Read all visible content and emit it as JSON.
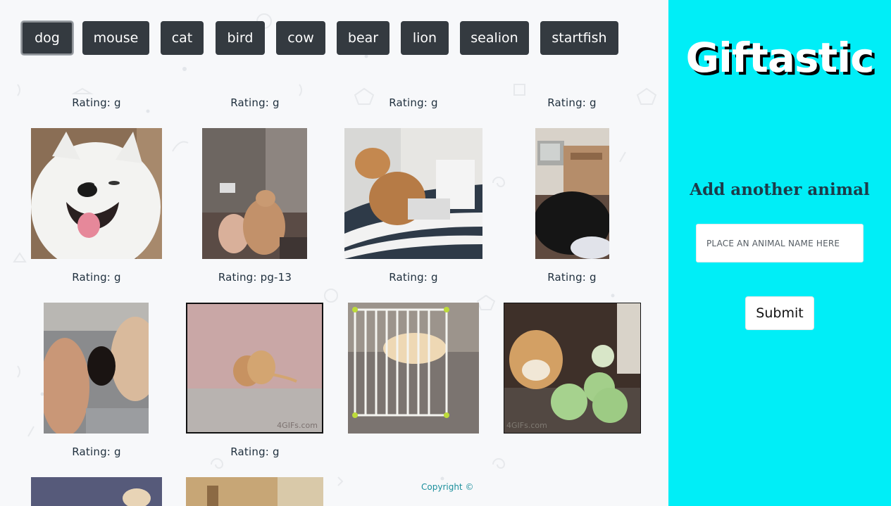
{
  "buttons": [
    "dog",
    "mouse",
    "cat",
    "bird",
    "cow",
    "bear",
    "lion",
    "sealion",
    "startfish"
  ],
  "active_button": "dog",
  "gifs": [
    {
      "rating": "Rating: g"
    },
    {
      "rating": "Rating: g"
    },
    {
      "rating": "Rating: g"
    },
    {
      "rating": "Rating: g"
    },
    {
      "rating": "Rating: g"
    },
    {
      "rating": "Rating: pg-13"
    },
    {
      "rating": "Rating: g"
    },
    {
      "rating": "Rating: g"
    },
    {
      "rating": "Rating: g"
    },
    {
      "rating": "Rating: g"
    }
  ],
  "watermarks": {
    "gif6": "4GIFs.com",
    "gif8": "4GIFs.com"
  },
  "footer": {
    "copyright": "Copyright ©"
  },
  "sidebar": {
    "brand": "Giftastic",
    "add_title": "Add another animal",
    "input_placeholder": "PLACE AN ANIMAL NAME HERE",
    "input_value": "",
    "submit_label": "Submit"
  },
  "colors": {
    "sidebar_bg": "#00eef7",
    "button_bg": "#343a40",
    "page_bg": "#f7f8fa"
  }
}
